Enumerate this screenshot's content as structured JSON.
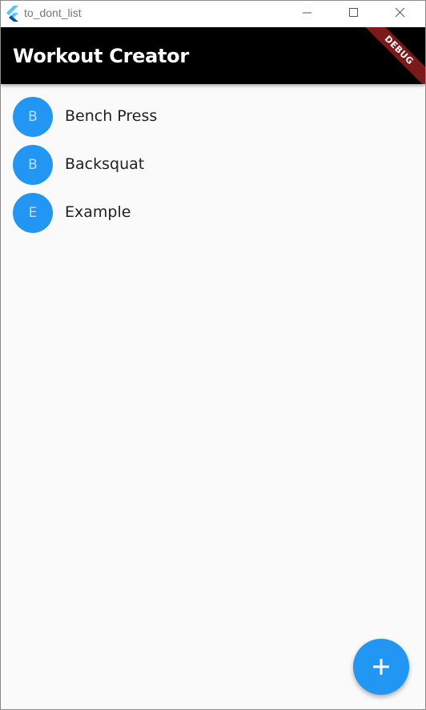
{
  "window": {
    "title": "to_dont_list",
    "icon": "flutter-logo-icon",
    "controls": [
      "minimize-icon",
      "maximize-icon",
      "close-icon"
    ]
  },
  "appbar": {
    "title": "Workout Creator",
    "debug_banner": "DEBUG"
  },
  "workouts": [
    {
      "initial": "B",
      "name": "Bench Press"
    },
    {
      "initial": "B",
      "name": "Backsquat"
    },
    {
      "initial": "E",
      "name": "Example"
    }
  ],
  "fab": {
    "icon": "plus-icon"
  },
  "colors": {
    "appbar_bg": "#000000",
    "accent": "#2196f3",
    "background": "#fafafa",
    "debug_banner": "#7a1a1a"
  }
}
